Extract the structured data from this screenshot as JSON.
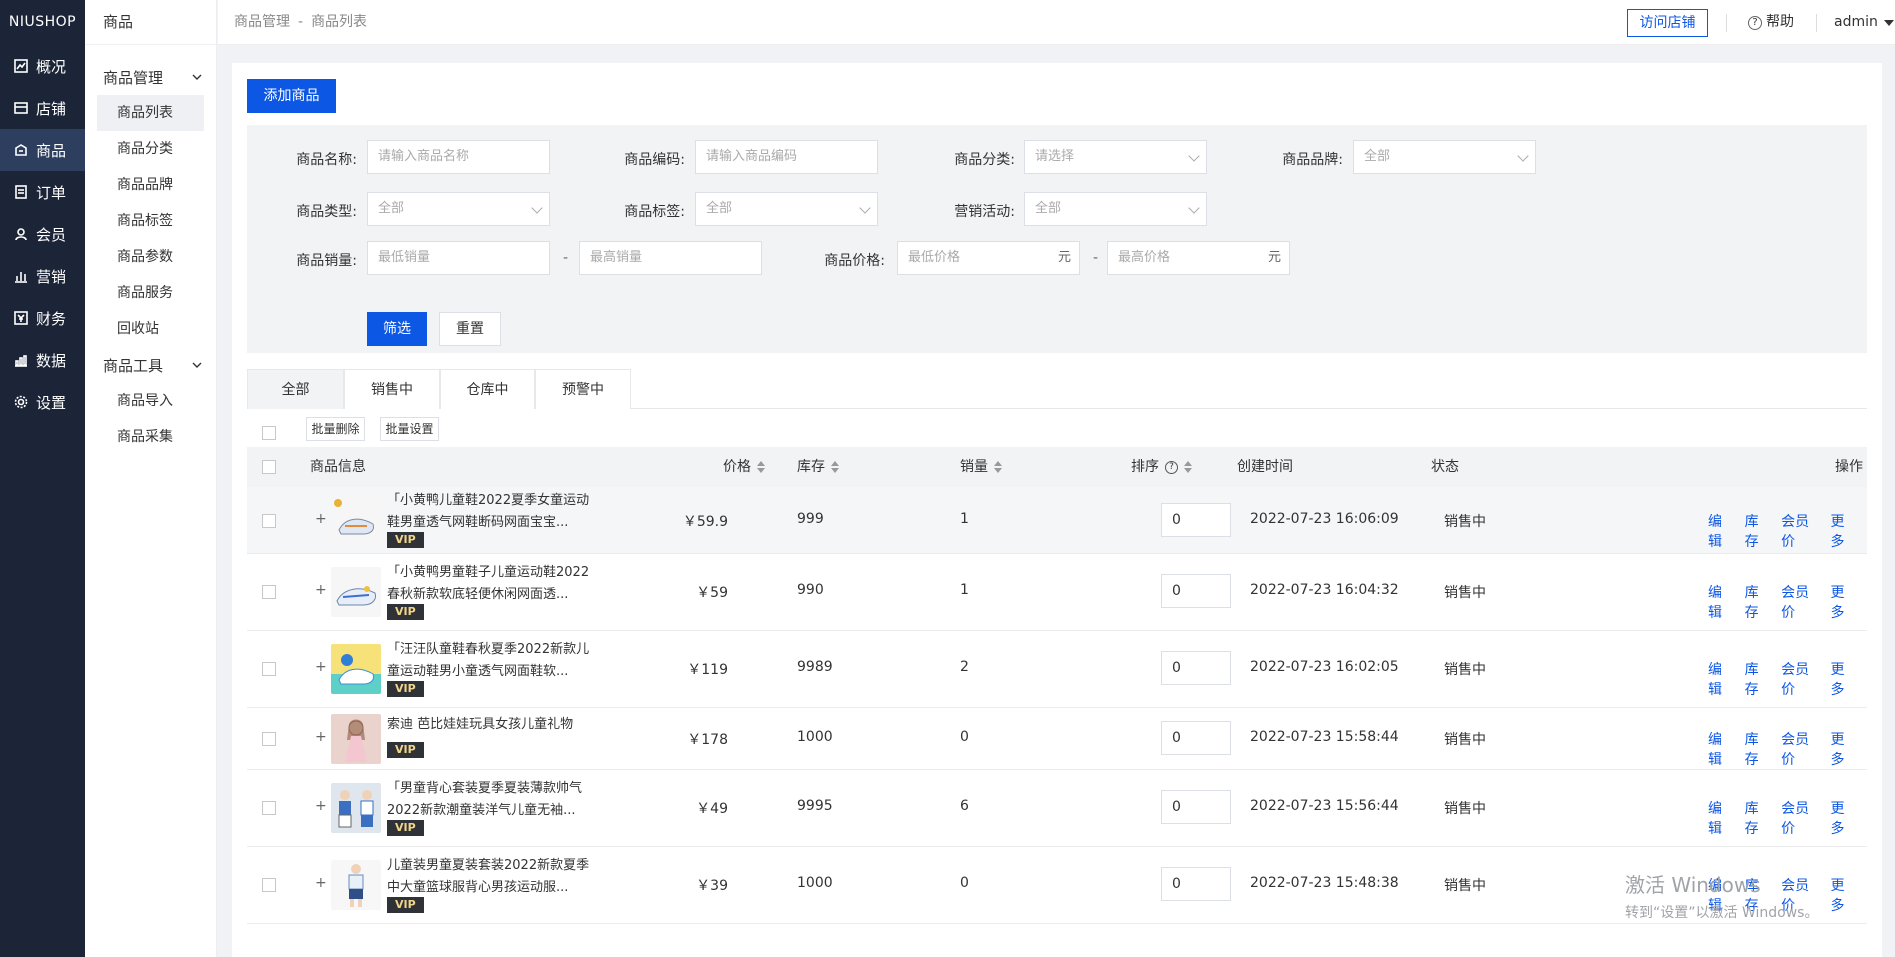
{
  "sidebar": {
    "logo": "NIUSHOP",
    "items": [
      {
        "label": "概况",
        "icon": "chart-line-icon"
      },
      {
        "label": "店铺",
        "icon": "store-icon"
      },
      {
        "label": "商品",
        "icon": "goods-icon"
      },
      {
        "label": "订单",
        "icon": "order-icon"
      },
      {
        "label": "会员",
        "icon": "user-icon"
      },
      {
        "label": "营销",
        "icon": "bar-chart-icon"
      },
      {
        "label": "财务",
        "icon": "yen-icon"
      },
      {
        "label": "数据",
        "icon": "data-icon"
      },
      {
        "label": "设置",
        "icon": "gear-icon"
      }
    ],
    "active_index": 2
  },
  "submenu": {
    "title": "商品",
    "group1": {
      "label": "商品管理",
      "items": [
        "商品列表",
        "商品分类",
        "商品品牌",
        "商品标签",
        "商品参数",
        "商品服务",
        "回收站"
      ]
    },
    "group2": {
      "label": "商品工具",
      "items": [
        "商品导入",
        "商品采集"
      ]
    }
  },
  "header": {
    "breadcrumb": [
      "商品管理",
      "商品列表"
    ],
    "breadcrumb_sep": "-",
    "visit_store": "访问店铺",
    "help": "帮助",
    "user": "admin"
  },
  "toolbar": {
    "add_goods": "添加商品"
  },
  "filter": {
    "name_label": "商品名称:",
    "name_placeholder": "请输入商品名称",
    "code_label": "商品编码:",
    "code_placeholder": "请输入商品编码",
    "category_label": "商品分类:",
    "category_value": "请选择",
    "brand_label": "商品品牌:",
    "brand_value": "全部",
    "type_label": "商品类型:",
    "type_value": "全部",
    "tag_label": "商品标签:",
    "tag_value": "全部",
    "activity_label": "营销活动:",
    "activity_value": "全部",
    "sales_label": "商品销量:",
    "sales_min": "最低销量",
    "sales_max": "最高销量",
    "price_label": "商品价格:",
    "price_min": "最低价格",
    "price_max": "最高价格",
    "price_unit": "元",
    "dash": "-",
    "submit": "筛选",
    "reset": "重置"
  },
  "tabs": [
    "全部",
    "销售中",
    "仓库中",
    "预警中"
  ],
  "batch": {
    "delete": "批量删除",
    "set": "批量设置"
  },
  "table": {
    "headers": {
      "info": "商品信息",
      "price": "价格",
      "stock": "库存",
      "sales": "销量",
      "sort": "排序",
      "created": "创建时间",
      "status": "状态",
      "action": "操作"
    },
    "ops": [
      "编辑",
      "库存",
      "会员价",
      "更多"
    ],
    "vip": "VIP",
    "rows": [
      {
        "name": "「小黄鸭儿童鞋2022夏季女童运动鞋男童透气网鞋断码网面宝宝...",
        "price": "￥59.9",
        "stock": "999",
        "sales": "1",
        "sort": "0",
        "created": "2022-07-23 16:06:09",
        "status": "销售中"
      },
      {
        "name": "「小黄鸭男童鞋子儿童运动鞋2022春秋新款软底轻便休闲网面透...",
        "price": "￥59",
        "stock": "990",
        "sales": "1",
        "sort": "0",
        "created": "2022-07-23 16:04:32",
        "status": "销售中"
      },
      {
        "name": "「汪汪队童鞋春秋夏季2022新款儿童运动鞋男小童透气网面鞋软...",
        "price": "￥119",
        "stock": "9989",
        "sales": "2",
        "sort": "0",
        "created": "2022-07-23 16:02:05",
        "status": "销售中"
      },
      {
        "name": "索迪 芭比娃娃玩具女孩儿童礼物",
        "price": "￥178",
        "stock": "1000",
        "sales": "0",
        "sort": "0",
        "created": "2022-07-23 15:58:44",
        "status": "销售中"
      },
      {
        "name": "「男童背心套装夏季夏装薄款帅气2022新款潮童装洋气儿童无袖...",
        "price": "￥49",
        "stock": "9995",
        "sales": "6",
        "sort": "0",
        "created": "2022-07-23 15:56:44",
        "status": "销售中"
      },
      {
        "name": "儿童装男童夏装套装2022新款夏季中大童篮球服背心男孩运动服...",
        "price": "￥39",
        "stock": "1000",
        "sales": "0",
        "sort": "0",
        "created": "2022-07-23 15:48:38",
        "status": "销售中"
      }
    ]
  },
  "watermark": {
    "line1": "激活 Windows",
    "line2": "转到“设置”以激活 Windows。"
  }
}
